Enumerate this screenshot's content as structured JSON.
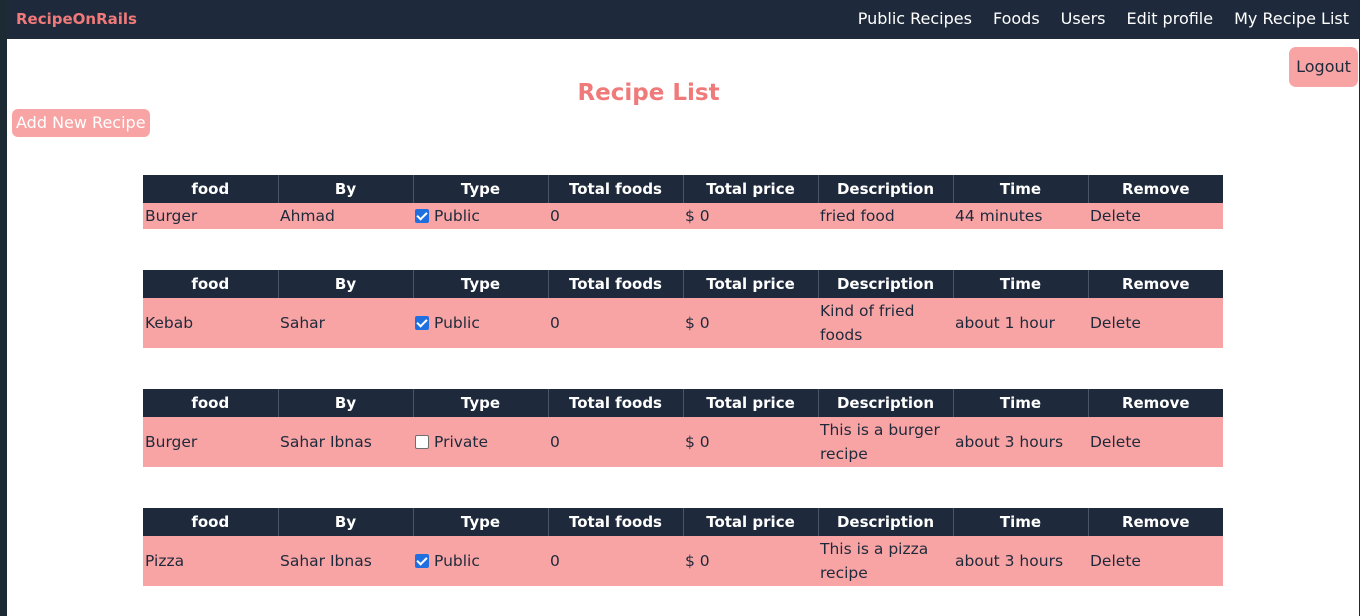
{
  "nav": {
    "brand": "RecipeOnRails",
    "links": [
      "Public Recipes",
      "Foods",
      "Users",
      "Edit profile",
      "My Recipe List"
    ]
  },
  "logout_label": "Logout",
  "page_title": "Recipe List",
  "add_button_label": "Add New Recipe",
  "table_headers": [
    "food",
    "By",
    "Type",
    "Total foods",
    "Total price",
    "Description",
    "Time",
    "Remove"
  ],
  "recipes": [
    {
      "food": "Burger",
      "by": "Ahmad",
      "public": true,
      "type": "Public",
      "total_foods": "0",
      "total_price": "$ 0",
      "description": "fried food",
      "time": "44 minutes",
      "remove": "Delete"
    },
    {
      "food": "Kebab",
      "by": "Sahar",
      "public": true,
      "type": "Public",
      "total_foods": "0",
      "total_price": "$ 0",
      "description": "Kind of fried foods",
      "time": "about 1 hour",
      "remove": "Delete"
    },
    {
      "food": "Burger",
      "by": "Sahar Ibnas",
      "public": false,
      "type": "Private",
      "total_foods": "0",
      "total_price": "$ 0",
      "description": "This is a burger recipe",
      "time": "about 3 hours",
      "remove": "Delete"
    },
    {
      "food": "Pizza",
      "by": "Sahar Ibnas",
      "public": true,
      "type": "Public",
      "total_foods": "0",
      "total_price": "$ 0",
      "description": "This is a pizza recipe",
      "time": "about 3 hours",
      "remove": "Delete"
    }
  ],
  "colors": {
    "navbar": "#1e2a3b",
    "accent": "#f07a7a",
    "row_background": "#f9a4a4",
    "checkbox_checked": "#1f6fe0"
  }
}
